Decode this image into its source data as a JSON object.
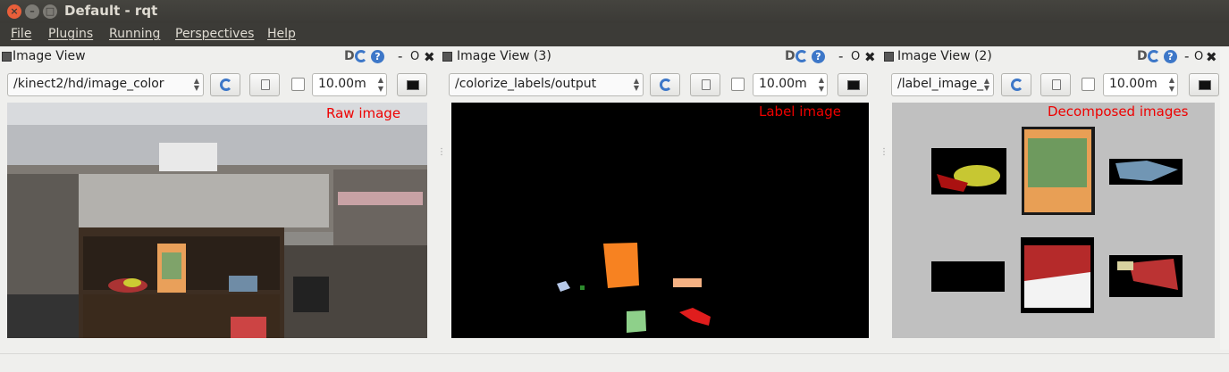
{
  "window": {
    "title": "Default - rqt"
  },
  "menu": [
    "File",
    "Plugins",
    "Running",
    "Perspectives",
    "Help"
  ],
  "panels": [
    {
      "title": "Image View",
      "topic": "/kinect2/hd/image_color",
      "depth": "10.00m",
      "overlay": "Raw image",
      "tools": {
        "d": "D",
        "dash": "-",
        "o": "O",
        "x": "✖",
        "q": "?"
      }
    },
    {
      "title": "Image View (3)",
      "topic": "/colorize_labels/output",
      "depth": "10.00m",
      "overlay": "Label image",
      "tools": {
        "d": "D",
        "dash": "-",
        "o": "O",
        "x": "✖",
        "q": "?"
      }
    },
    {
      "title": "Image View (2)",
      "topic": "/label_image_",
      "depth": "10.00m",
      "overlay": "Decomposed images",
      "tools": {
        "d": "D",
        "dash": "-",
        "o": "O",
        "x": "✖",
        "q": "?"
      }
    }
  ],
  "colors": {
    "overlay_text": "#e00000",
    "accent": "#3d77c8",
    "titlebar": "#3c3b37"
  }
}
